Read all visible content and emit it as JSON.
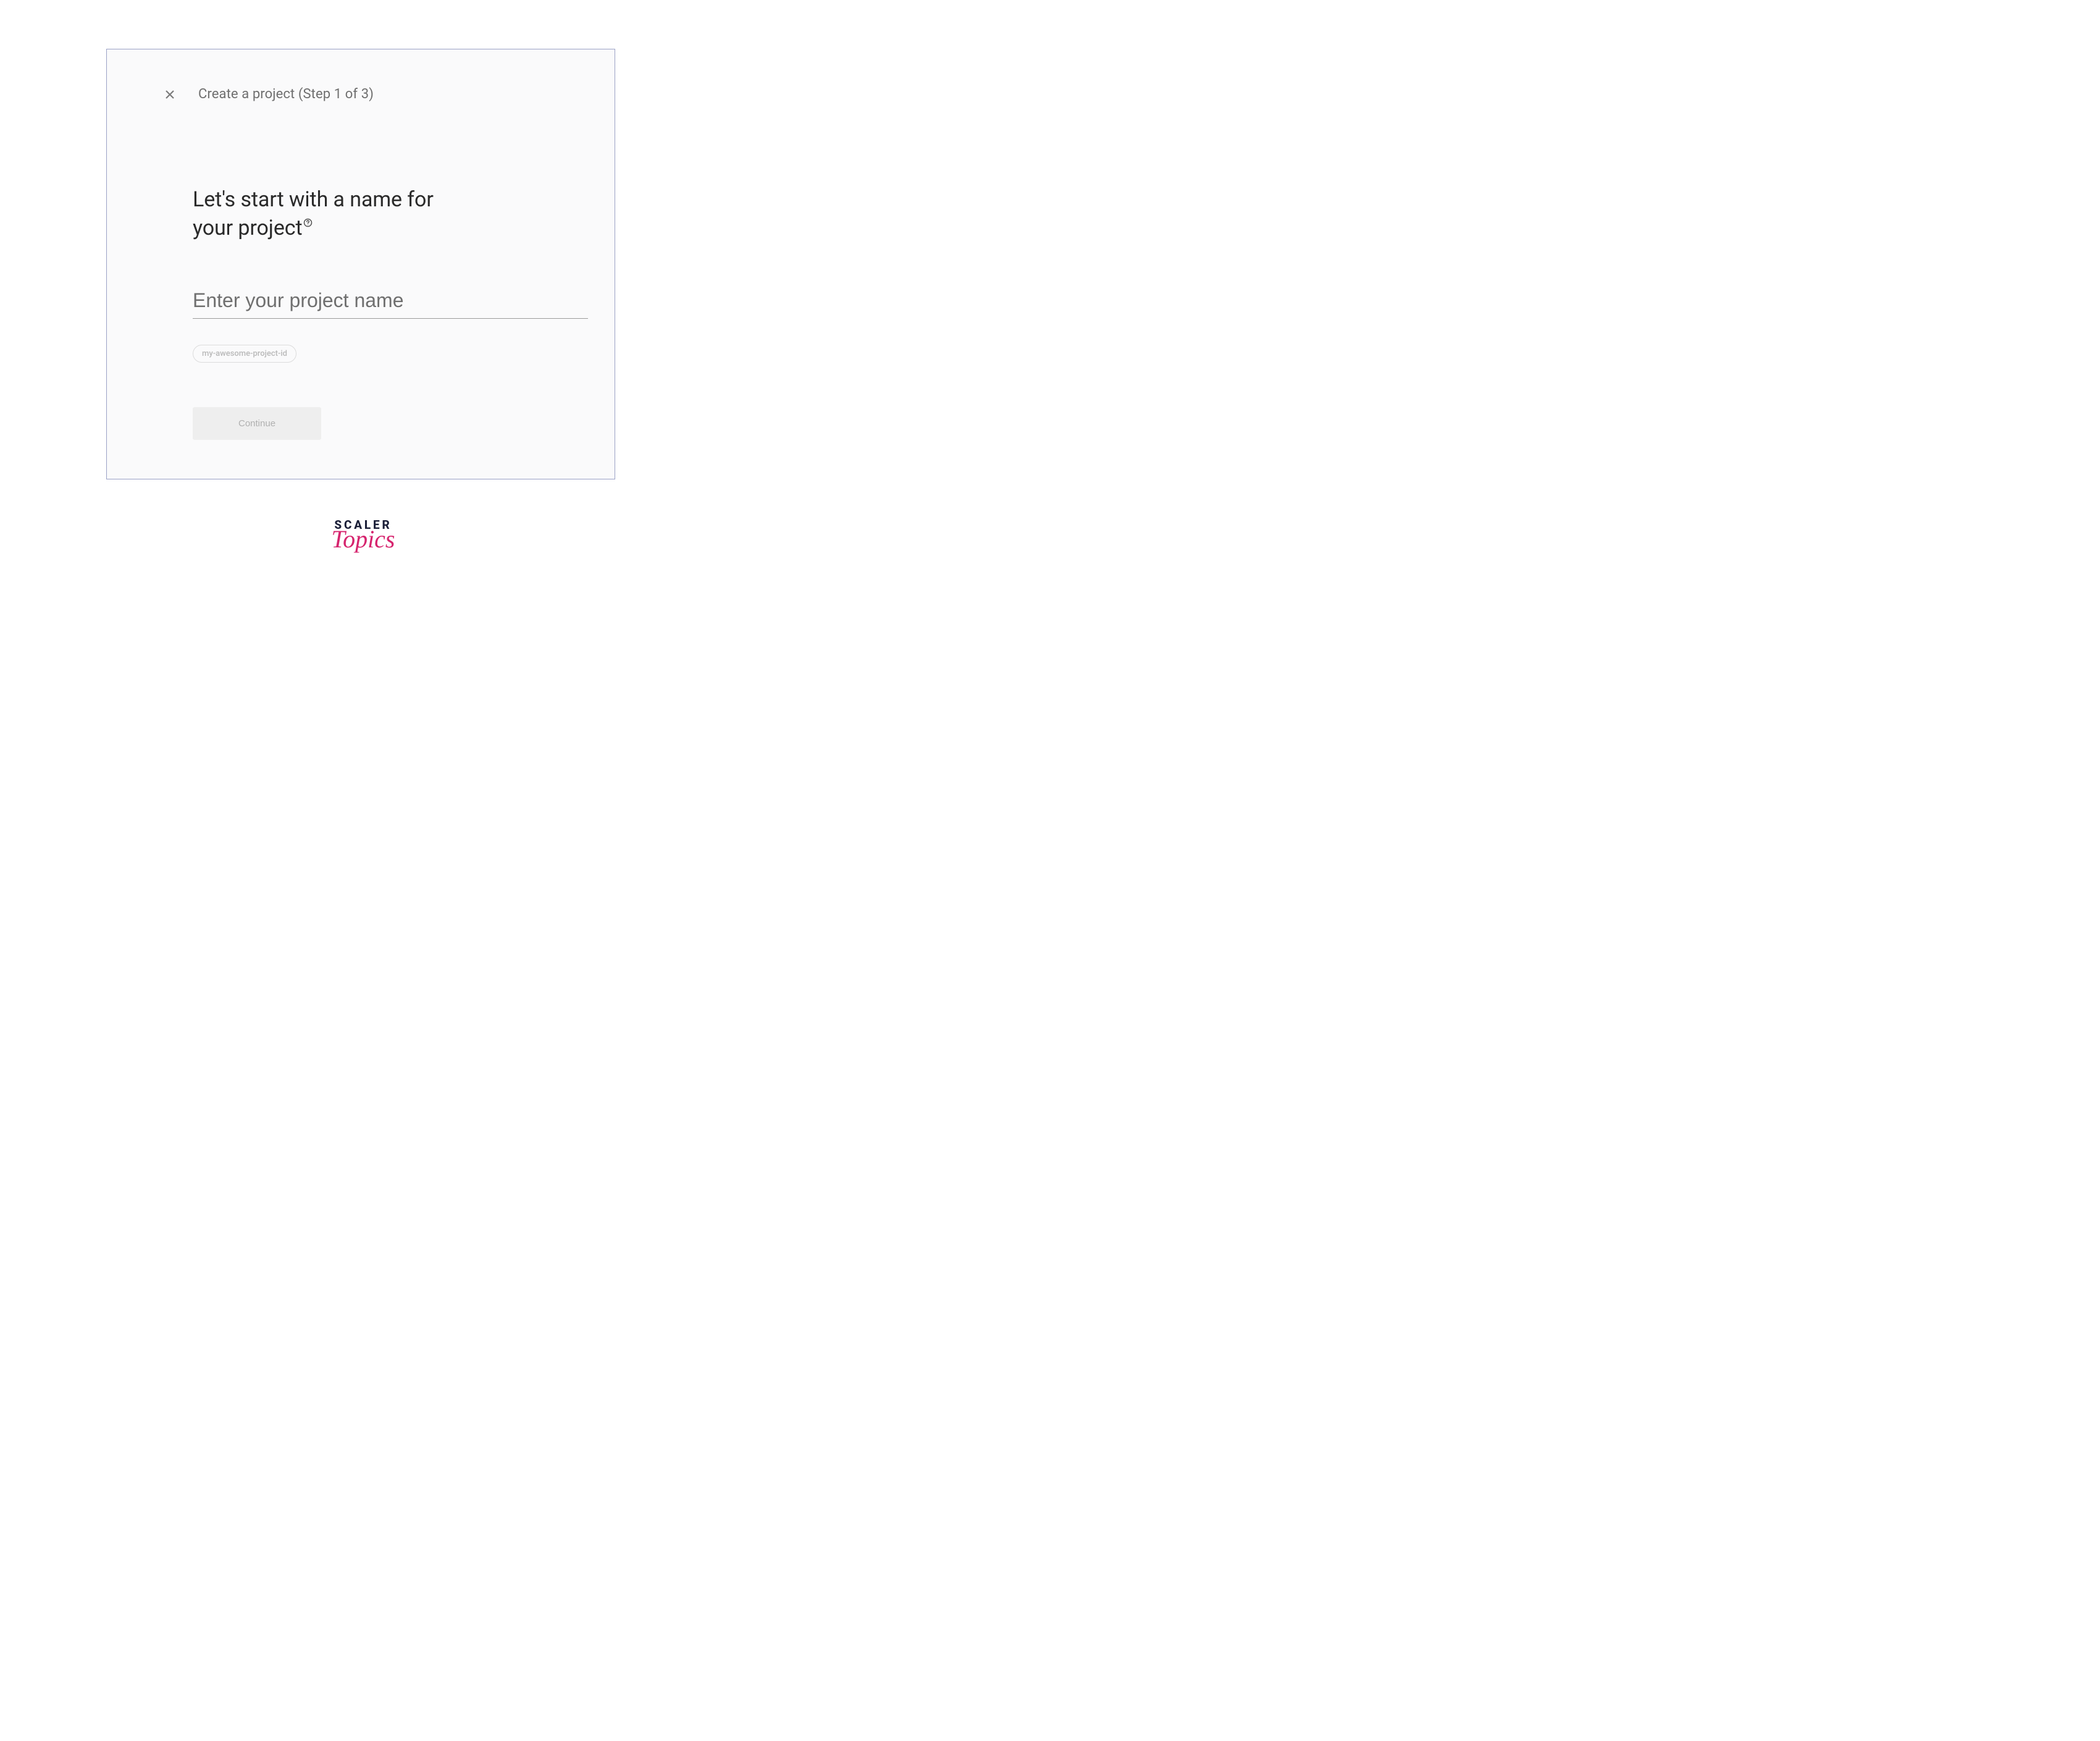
{
  "header": {
    "title": "Create a project (Step 1 of 3)"
  },
  "main": {
    "heading_line1": "Let's start with a name for",
    "heading_line2": "your project",
    "project_name_placeholder": "Enter your project name",
    "project_id_chip": "my-awesome-project-id",
    "continue_label": "Continue"
  },
  "footer": {
    "brand_top": "SCALER",
    "brand_bottom": "Topics"
  }
}
